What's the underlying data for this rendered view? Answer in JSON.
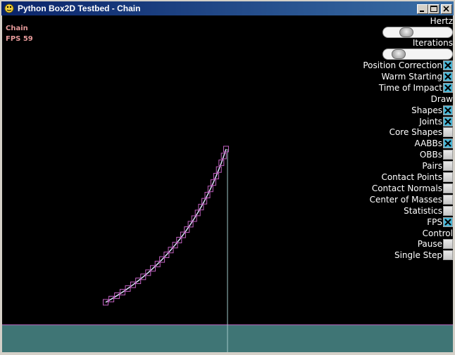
{
  "window": {
    "title": "Python Box2D Testbed - Chain"
  },
  "hud": {
    "test_name": "Chain",
    "fps": "FPS 59"
  },
  "settings": {
    "sliders": [
      {
        "label": "Hertz",
        "value": 0.3
      },
      {
        "label": "Iterations",
        "value": 0.15
      }
    ],
    "options": [
      {
        "label": "Position Correction",
        "checkbox": true,
        "checked": true
      },
      {
        "label": "Warm Starting",
        "checkbox": true,
        "checked": true
      },
      {
        "label": "Time of Impact",
        "checkbox": true,
        "checked": true
      },
      {
        "label": "Draw",
        "checkbox": false
      },
      {
        "label": "Shapes",
        "checkbox": true,
        "checked": true
      },
      {
        "label": "Joints",
        "checkbox": true,
        "checked": true
      },
      {
        "label": "Core Shapes",
        "checkbox": true,
        "checked": false
      },
      {
        "label": "AABBs",
        "checkbox": true,
        "checked": true
      },
      {
        "label": "OBBs",
        "checkbox": true,
        "checked": false
      },
      {
        "label": "Pairs",
        "checkbox": true,
        "checked": false
      },
      {
        "label": "Contact Points",
        "checkbox": true,
        "checked": false
      },
      {
        "label": "Contact Normals",
        "checkbox": true,
        "checked": false
      },
      {
        "label": "Center of Masses",
        "checkbox": true,
        "checked": false
      },
      {
        "label": "Statistics",
        "checkbox": true,
        "checked": false
      },
      {
        "label": "FPS",
        "checkbox": true,
        "checked": true
      },
      {
        "label": "Control",
        "checkbox": false
      },
      {
        "label": "Pause",
        "checkbox": true,
        "checked": false
      },
      {
        "label": "Single Step",
        "checkbox": true,
        "checked": false
      }
    ]
  },
  "colors": {
    "background": "#000000",
    "ground": "#3f7575",
    "chain_box": "#c060c0",
    "chain_line": "#e0e0ff",
    "hud_text": "#e69a9a",
    "checkbox_on": "#4ab8d8"
  }
}
